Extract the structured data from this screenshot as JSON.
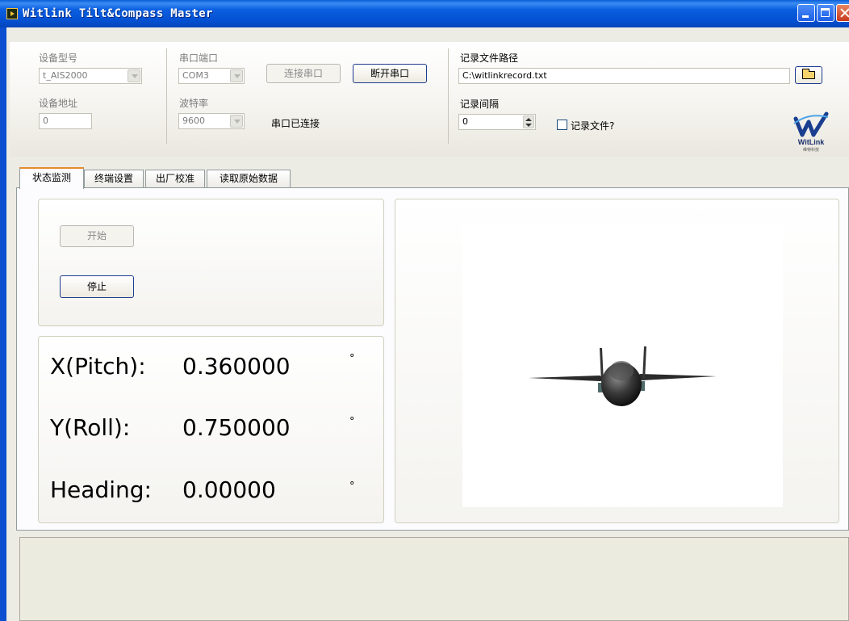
{
  "window": {
    "title": "Witlink Tilt&Compass Master"
  },
  "device": {
    "model_label": "设备型号",
    "model_value": "t_AIS2000",
    "address_label": "设备地址",
    "address_value": "0"
  },
  "serial": {
    "port_label": "串口端口",
    "port_value": "COM3",
    "baud_label": "波特率",
    "baud_value": "9600",
    "connect_label": "连接串口",
    "disconnect_label": "断开串口",
    "status_text": "串口已连接"
  },
  "record": {
    "path_label": "记录文件路径",
    "path_value": "C:\\witlinkrecord.txt",
    "interval_label": "记录间隔",
    "interval_value": "0",
    "checkbox_label": "记录文件?"
  },
  "logo": {
    "text": "WitLink",
    "subtext": "维特科技"
  },
  "tabs": [
    {
      "label": "状态监测",
      "active": true
    },
    {
      "label": "终端设置",
      "active": false
    },
    {
      "label": "出厂校准",
      "active": false
    },
    {
      "label": "读取原始数据",
      "active": false
    }
  ],
  "controls": {
    "start_label": "开始",
    "stop_label": "停止"
  },
  "readouts": {
    "pitch_label": "X(Pitch):",
    "pitch_value": "0.360000",
    "roll_label": "Y(Roll):",
    "roll_value": "0.750000",
    "heading_label": "Heading:",
    "heading_value": "0.00000",
    "unit": "°"
  },
  "colors": {
    "titlebar": "#0a5fe0",
    "tab_active_accent": "#e68b2c",
    "button_border": "#1f3c8e"
  }
}
